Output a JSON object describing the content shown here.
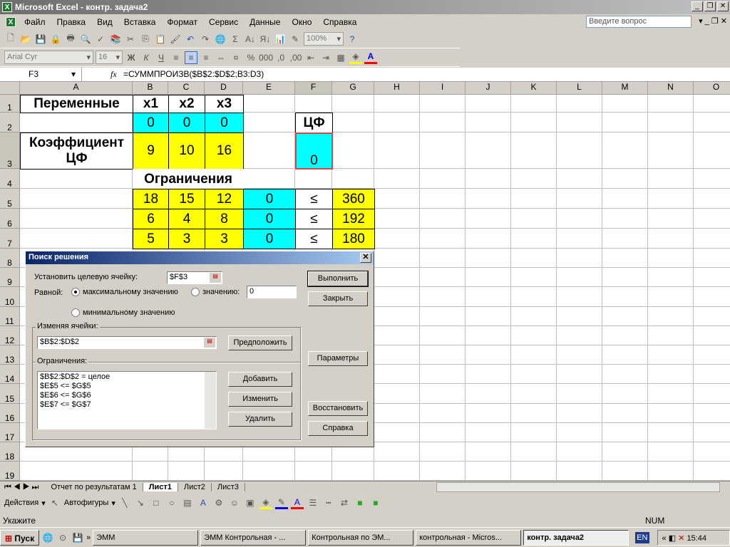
{
  "window": {
    "title": "Microsoft Excel - контр. задача2"
  },
  "menu": [
    "Файл",
    "Правка",
    "Вид",
    "Вставка",
    "Формат",
    "Сервис",
    "Данные",
    "Окно",
    "Справка"
  ],
  "help_placeholder": "Введите вопрос",
  "toolbar": {
    "zoom": "100%",
    "font": "Arial Cyr",
    "size": "16"
  },
  "formula_bar": {
    "name_box": "F3",
    "fx": "fx",
    "formula": "=СУММПРОИЗВ($B$2:$D$2;B3:D3)"
  },
  "columns": [
    "A",
    "B",
    "C",
    "D",
    "E",
    "F",
    "G",
    "H",
    "I",
    "J",
    "K",
    "L",
    "M",
    "N",
    "O"
  ],
  "rows": [
    "1",
    "2",
    "3",
    "4",
    "5",
    "6",
    "7",
    "8",
    "9",
    "10",
    "11",
    "12",
    "13",
    "14",
    "15",
    "16",
    "17",
    "18",
    "19"
  ],
  "colors": {
    "cyan": "#00ffff",
    "yellow": "#ffff00",
    "white": "#ffffff"
  },
  "cells": [
    {
      "ref": "A1",
      "v": "Переменные",
      "fill": "#ffffff",
      "bold": true,
      "box": true
    },
    {
      "ref": "B1",
      "v": "x1",
      "fill": "#ffffff",
      "bold": true,
      "box": true
    },
    {
      "ref": "C1",
      "v": "x2",
      "fill": "#ffffff",
      "bold": true,
      "box": true
    },
    {
      "ref": "D1",
      "v": "x3",
      "fill": "#ffffff",
      "bold": true,
      "box": true
    },
    {
      "ref": "B2",
      "v": "0",
      "fill": "#00ffff",
      "box": true
    },
    {
      "ref": "C2",
      "v": "0",
      "fill": "#00ffff",
      "box": true
    },
    {
      "ref": "D2",
      "v": "0",
      "fill": "#00ffff",
      "box": true
    },
    {
      "ref": "F2",
      "v": "ЦФ",
      "fill": "#ffffff",
      "bold": true,
      "box": true
    },
    {
      "ref": "A3",
      "v": "Коэффициент ЦФ",
      "fill": "#ffffff",
      "bold": true,
      "box": true
    },
    {
      "ref": "B3",
      "v": "9",
      "fill": "#ffff00",
      "box": true
    },
    {
      "ref": "C3",
      "v": "10",
      "fill": "#ffff00",
      "box": true
    },
    {
      "ref": "D3",
      "v": "16",
      "fill": "#ffff00",
      "box": true
    },
    {
      "ref": "F3",
      "v": "0",
      "fill": "#00ffff",
      "box": true,
      "bottom": true
    },
    {
      "ref": "B4",
      "v": "Ограничения",
      "fill": "#ffffff",
      "bold": true,
      "span": 3
    },
    {
      "ref": "B5",
      "v": "18",
      "fill": "#ffff00",
      "box": true
    },
    {
      "ref": "C5",
      "v": "15",
      "fill": "#ffff00",
      "box": true
    },
    {
      "ref": "D5",
      "v": "12",
      "fill": "#ffff00",
      "box": true
    },
    {
      "ref": "E5",
      "v": "0",
      "fill": "#00ffff",
      "box": true
    },
    {
      "ref": "F5",
      "v": "≤",
      "fill": "#ffffff",
      "box": true
    },
    {
      "ref": "G5",
      "v": "360",
      "fill": "#ffff00",
      "box": true
    },
    {
      "ref": "B6",
      "v": "6",
      "fill": "#ffff00",
      "box": true
    },
    {
      "ref": "C6",
      "v": "4",
      "fill": "#ffff00",
      "box": true
    },
    {
      "ref": "D6",
      "v": "8",
      "fill": "#ffff00",
      "box": true
    },
    {
      "ref": "E6",
      "v": "0",
      "fill": "#00ffff",
      "box": true
    },
    {
      "ref": "F6",
      "v": "≤",
      "fill": "#ffffff",
      "box": true
    },
    {
      "ref": "G6",
      "v": "192",
      "fill": "#ffff00",
      "box": true
    },
    {
      "ref": "B7",
      "v": "5",
      "fill": "#ffff00",
      "box": true
    },
    {
      "ref": "C7",
      "v": "3",
      "fill": "#ffff00",
      "box": true
    },
    {
      "ref": "D7",
      "v": "3",
      "fill": "#ffff00",
      "box": true
    },
    {
      "ref": "E7",
      "v": "0",
      "fill": "#00ffff",
      "box": true
    },
    {
      "ref": "F7",
      "v": "≤",
      "fill": "#ffffff",
      "box": true
    },
    {
      "ref": "G7",
      "v": "180",
      "fill": "#ffff00",
      "box": true
    }
  ],
  "solver": {
    "title": "Поиск решения",
    "target_label": "Установить целевую ячейку:",
    "target_value": "$F$3",
    "equal_label": "Равной:",
    "opt_max": "максимальному значению",
    "opt_value": "значению:",
    "value_input": "0",
    "opt_min": "минимальному значению",
    "changing_label": "Изменяя ячейки:",
    "changing_value": "$B$2:$D$2",
    "guess": "Предположить",
    "constraints_label": "Ограничения:",
    "constraints": [
      "$B$2:$D$2 = целое",
      "$E$5 <= $G$5",
      "$E$6 <= $G$6",
      "$E$7 <= $G$7"
    ],
    "add": "Добавить",
    "change": "Изменить",
    "delete": "Удалить",
    "solve": "Выполнить",
    "close": "Закрыть",
    "options": "Параметры",
    "reset": "Восстановить",
    "help": "Справка"
  },
  "sheets": [
    "Отчет по результатам 1",
    "Лист1",
    "Лист2",
    "Лист3"
  ],
  "active_sheet": "Лист1",
  "drawing": {
    "actions": "Действия",
    "autoshapes": "Автофигуры"
  },
  "status": {
    "mode": "Укажите",
    "num": "NUM"
  },
  "taskbar": {
    "start": "Пуск",
    "items": [
      "ЭММ",
      "ЭММ Контрольная - ...",
      "Контрольная по ЭМ...",
      "контрольная - Micros...",
      "контр. задача2"
    ],
    "lang": "EN",
    "clock": "15:44"
  }
}
